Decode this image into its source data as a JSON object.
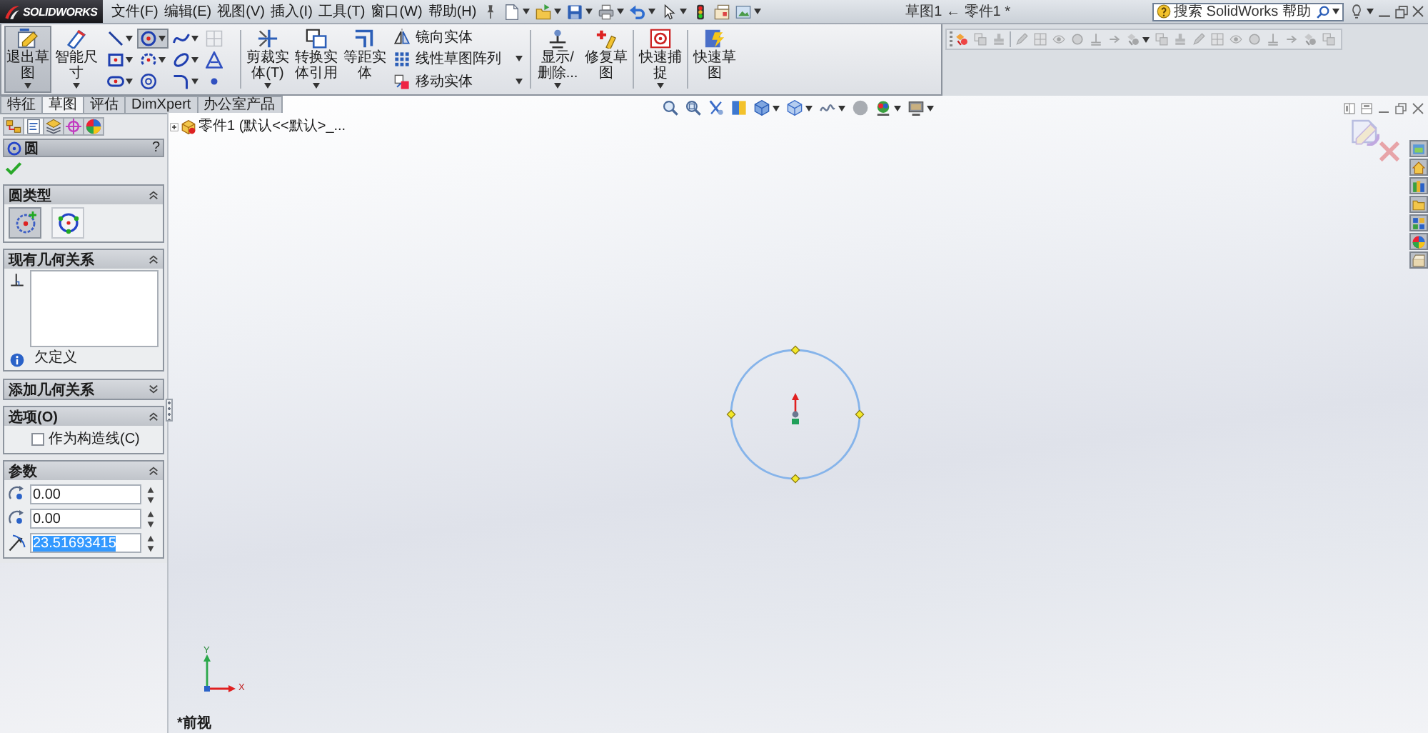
{
  "title_bar": {
    "brand": "SOLIDWORKS",
    "menu": [
      "文件(F)",
      "编辑(E)",
      "视图(V)",
      "插入(I)",
      "工具(T)",
      "窗口(W)",
      "帮助(H)"
    ],
    "quick_access": [
      {
        "dropdown": true
      },
      {
        "dropdown": true
      },
      {
        "dropdown": true
      },
      {
        "dropdown": true
      },
      {
        "dropdown": true
      },
      {
        "dropdown": true
      },
      {
        "dropdown": false
      },
      {
        "dropdown": false
      },
      {
        "dropdown": true
      }
    ],
    "document_title": "草图1 ← 零件1 *",
    "search": {
      "placeholder": "搜索 SolidWorks 帮助"
    }
  },
  "ribbon": {
    "items": [
      {
        "kind": "large",
        "label": "退出草图",
        "selected": true,
        "dropdown": true
      },
      {
        "kind": "large",
        "label": "智能尺寸",
        "selected": false,
        "dropdown": true
      },
      {
        "kind": "grid",
        "tools": [
          {
            "selected": false,
            "dropdown": true,
            "disabled": false
          },
          {
            "selected": true,
            "dropdown": true,
            "disabled": false
          },
          {
            "selected": false,
            "dropdown": true,
            "disabled": false
          },
          {
            "selected": false,
            "dropdown": false,
            "disabled": true
          },
          {
            "selected": false,
            "dropdown": true,
            "disabled": false
          },
          {
            "selected": false,
            "dropdown": true,
            "disabled": false
          },
          {
            "selected": false,
            "dropdown": true,
            "disabled": false
          },
          {
            "selected": false,
            "dropdown": false,
            "disabled": false
          },
          {
            "selected": false,
            "dropdown": true,
            "disabled": false
          },
          {
            "selected": false,
            "dropdown": false,
            "disabled": false
          },
          {
            "selected": false,
            "dropdown": true,
            "disabled": false
          },
          {
            "selected": false,
            "dropdown": false,
            "disabled": false
          }
        ]
      },
      {
        "kind": "separator"
      },
      {
        "kind": "large",
        "label": "剪裁实体(T)",
        "selected": false,
        "dropdown": true
      },
      {
        "kind": "large",
        "label": "转换实体引用",
        "selected": false,
        "dropdown": true
      },
      {
        "kind": "large",
        "label": "等距实体",
        "selected": false,
        "dropdown": false
      },
      {
        "kind": "stack",
        "rows": [
          {
            "label": "镜向实体",
            "dropdown": false
          },
          {
            "label": "线性草图阵列",
            "dropdown": true
          },
          {
            "label": "移动实体",
            "dropdown": true
          }
        ]
      },
      {
        "kind": "separator"
      },
      {
        "kind": "large",
        "label": "显示/删除...",
        "selected": false,
        "dropdown": true
      },
      {
        "kind": "large",
        "label": "修复草图",
        "selected": false,
        "dropdown": false
      },
      {
        "kind": "separator"
      },
      {
        "kind": "large",
        "label": "快速捕捉",
        "selected": false,
        "dropdown": true
      },
      {
        "kind": "separator"
      },
      {
        "kind": "large",
        "label": "快速草图",
        "selected": false,
        "dropdown": false
      }
    ]
  },
  "sketch_toolbar": {
    "groups": [
      [
        {
          "disabled": false,
          "dropdown": false
        },
        {
          "disabled": true,
          "dropdown": false
        },
        {
          "disabled": true,
          "dropdown": false
        }
      ],
      [
        {
          "disabled": true,
          "dropdown": false
        },
        {
          "disabled": true,
          "dropdown": false
        },
        {
          "disabled": true,
          "dropdown": false
        },
        {
          "disabled": true,
          "dropdown": false
        },
        {
          "disabled": true,
          "dropdown": false
        },
        {
          "disabled": true,
          "dropdown": false
        },
        {
          "disabled": true,
          "dropdown": true
        },
        {
          "disabled": true,
          "dropdown": false
        },
        {
          "disabled": true,
          "dropdown": false
        },
        {
          "disabled": true,
          "dropdown": false
        },
        {
          "disabled": true,
          "dropdown": false
        },
        {
          "disabled": true,
          "dropdown": false
        },
        {
          "disabled": true,
          "dropdown": false
        },
        {
          "disabled": true,
          "dropdown": false
        },
        {
          "disabled": true,
          "dropdown": false
        },
        {
          "disabled": true,
          "dropdown": false
        },
        {
          "disabled": true,
          "dropdown": false
        }
      ]
    ]
  },
  "command_tabs": [
    {
      "label": "特征",
      "selected": false
    },
    {
      "label": "草图",
      "selected": true
    },
    {
      "label": "评估",
      "selected": false
    },
    {
      "label": "DimXpert",
      "selected": false
    },
    {
      "label": "办公室产品",
      "selected": false
    }
  ],
  "left_panel": {
    "manager_tabs": [
      {
        "selected": false
      },
      {
        "selected": true
      },
      {
        "selected": false
      },
      {
        "selected": false
      },
      {
        "selected": false
      }
    ],
    "property_manager": {
      "title": "圆",
      "help": "?",
      "groups": [
        {
          "kind": "circle_type",
          "title": "圆类型",
          "expanded": true,
          "options": [
            {
              "selected": true
            },
            {
              "selected": false
            }
          ]
        },
        {
          "kind": "relations",
          "title": "现有几何关系",
          "expanded": true,
          "status": "欠定义"
        },
        {
          "kind": "add_relations",
          "title": "添加几何关系",
          "expanded": false
        },
        {
          "kind": "options",
          "title": "选项(O)",
          "expanded": true,
          "checkbox": {
            "label": "作为构造线(C)",
            "checked": false
          }
        },
        {
          "kind": "parameters",
          "title": "参数",
          "expanded": true,
          "fields": [
            {
              "value": "0.00",
              "selected": false
            },
            {
              "value": "0.00",
              "selected": false
            },
            {
              "value": "23.51693415",
              "selected": true
            }
          ]
        }
      ]
    }
  },
  "graphics": {
    "view_toolbar": [
      {
        "dropdown": false
      },
      {
        "dropdown": false
      },
      {
        "dropdown": false
      },
      {
        "dropdown": false
      },
      {
        "dropdown": true
      },
      {
        "dropdown": true
      },
      {
        "dropdown": true
      },
      {
        "dropdown": false
      },
      {
        "dropdown": true
      },
      {
        "dropdown": true
      }
    ],
    "feature_tree": {
      "label": "零件1 (默认<<默认>_...",
      "expanded": false
    },
    "triad": {
      "x_label": "X",
      "y_label": "Y"
    },
    "view_name": "*前视"
  }
}
